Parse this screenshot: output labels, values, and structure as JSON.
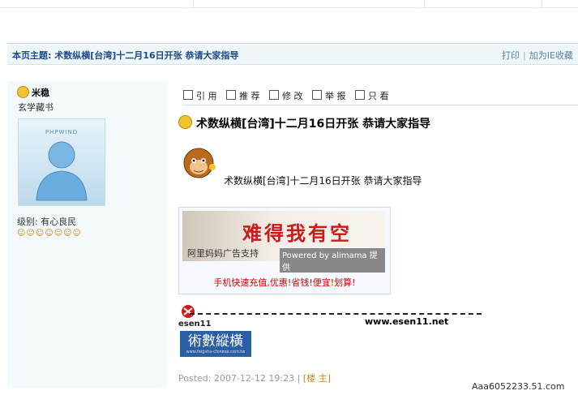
{
  "header": {
    "topic_label": "本页主题:",
    "topic": "术数纵横[台湾]十二月16日开张 恭请大家指导",
    "print": "打印",
    "separator": "|",
    "add_fav": "加为IE收藏"
  },
  "user": {
    "name": "米稳",
    "title": "玄学藏书",
    "avatar_text": "PHPWIND",
    "rank_label": "级别:",
    "rank": "有心良民",
    "stars": "☺☺☺☺☺☺☺"
  },
  "toolbar": [
    {
      "label": "引 用",
      "icon": "quote-icon"
    },
    {
      "label": "推 荐",
      "icon": "recommend-icon"
    },
    {
      "label": "修 改",
      "icon": "edit-icon"
    },
    {
      "label": "举 报",
      "icon": "report-icon"
    },
    {
      "label": "只 看",
      "icon": "view-only-icon"
    }
  ],
  "post": {
    "subject": "术数纵横[台湾]十二月16日开张 恭请大家指导",
    "body": "术数纵横[台湾]十二月16日开张 恭请大家指导",
    "footer_posted": "Posted: 2007-12-12 19:23",
    "footer_sep": "|",
    "footer_floor": "[楼 主]"
  },
  "ad": {
    "headline": "难得我有空",
    "support": "阿里妈妈广告支持",
    "powered": "Powered by alimama 提供",
    "bottom": "手机快速充值,优惠!省钱!便宜!划算!"
  },
  "signature": {
    "brand": "esen11",
    "url": "www.esen11.net",
    "banner": "術數縱橫",
    "banner_sub": "www.feigshu-chinese.com.tw"
  },
  "watermark": "Aaa6052233.51.com",
  "colors": {
    "header_bg": "#eef6f8",
    "title": "#1a4a8a",
    "user_col_bg": "#f4f9fb",
    "ad_red": "#cc1a1a"
  }
}
